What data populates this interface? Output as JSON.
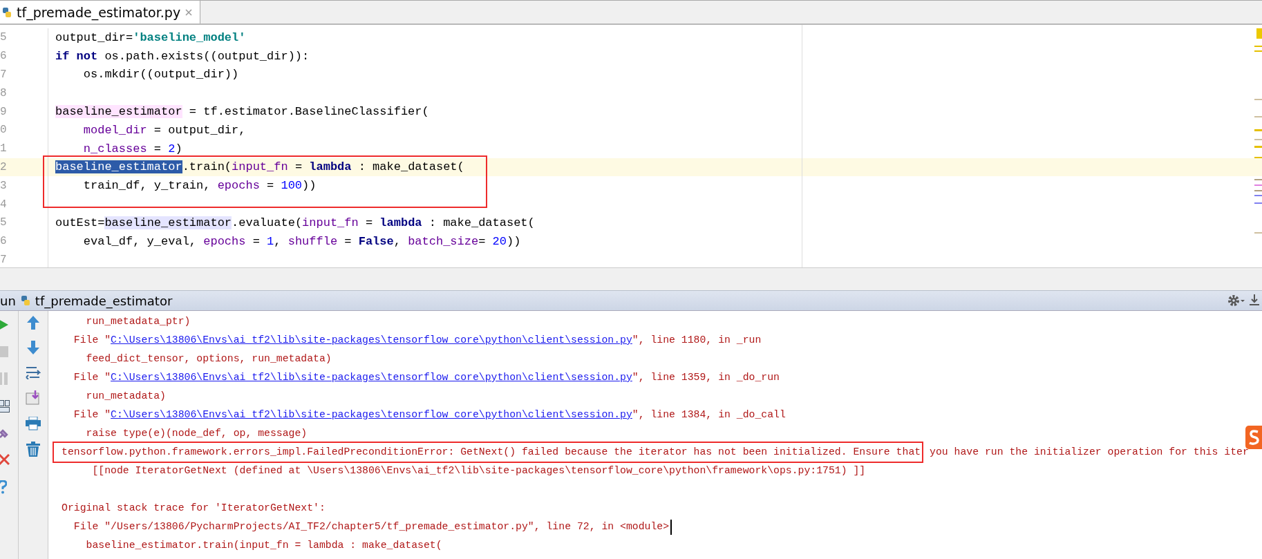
{
  "tab": {
    "label": "tf_premade_estimator.py",
    "selected": true
  },
  "editor": {
    "lines": [
      {
        "number": "5",
        "caret_line": false,
        "tokens": [
          {
            "kind": "plain",
            "text": "output_dir="
          },
          {
            "kind": "string",
            "text": "'baseline_model'"
          }
        ]
      },
      {
        "number": "6",
        "caret_line": false,
        "tokens": [
          {
            "kind": "keyword",
            "text": "if"
          },
          {
            "kind": "keyword",
            "text": " not"
          },
          {
            "kind": "plain",
            "text": " os.path.exists((output_dir)):"
          }
        ]
      },
      {
        "number": "7",
        "caret_line": false,
        "tokens": [
          {
            "kind": "plain",
            "text": "    os.mkdir((output_dir))"
          }
        ]
      },
      {
        "number": "8",
        "caret_line": false
      },
      {
        "number": "9",
        "caret_line": false,
        "tokens": [
          {
            "kind": "write-usage",
            "text": "baseline_estimator"
          },
          {
            "kind": "plain",
            "text": " = tf.estimator.BaselineClassifier("
          }
        ]
      },
      {
        "number": "0",
        "caret_line": false,
        "tokens": [
          {
            "kind": "param",
            "text": "    model_dir"
          },
          {
            "kind": "plain",
            "text": " = output_dir,"
          }
        ]
      },
      {
        "number": "1",
        "caret_line": false,
        "tokens": [
          {
            "kind": "param",
            "text": "    n_classes"
          },
          {
            "kind": "plain",
            "text": " = "
          },
          {
            "kind": "number",
            "text": "2"
          },
          {
            "kind": "plain",
            "text": ")"
          }
        ]
      },
      {
        "number": "2",
        "caret_line": true,
        "tokens": [
          {
            "kind": "selection",
            "text": "baseline_estimator"
          },
          {
            "kind": "plain",
            "text": ".train("
          },
          {
            "kind": "param",
            "text": "input_fn"
          },
          {
            "kind": "plain",
            "text": " = "
          },
          {
            "kind": "keyword",
            "text": "lambda"
          },
          {
            "kind": "plain",
            "text": " : make_dataset("
          }
        ]
      },
      {
        "number": "3",
        "caret_line": false,
        "tokens": [
          {
            "kind": "plain",
            "text": "    train_df, y_train, "
          },
          {
            "kind": "param",
            "text": "epochs"
          },
          {
            "kind": "plain",
            "text": " = "
          },
          {
            "kind": "number",
            "text": "100"
          },
          {
            "kind": "plain",
            "text": "))"
          }
        ]
      },
      {
        "number": "4",
        "caret_line": false
      },
      {
        "number": "5",
        "caret_line": false,
        "tokens": [
          {
            "kind": "plain",
            "text": "outEst="
          },
          {
            "kind": "read-usage",
            "text": "baseline_estimator"
          },
          {
            "kind": "plain",
            "text": ".evaluate("
          },
          {
            "kind": "param",
            "text": "input_fn"
          },
          {
            "kind": "plain",
            "text": " = "
          },
          {
            "kind": "keyword",
            "text": "lambda"
          },
          {
            "kind": "plain",
            "text": " : make_dataset("
          }
        ]
      },
      {
        "number": "6",
        "caret_line": false,
        "tokens": [
          {
            "kind": "plain",
            "text": "    eval_df, y_eval, "
          },
          {
            "kind": "param",
            "text": "epochs"
          },
          {
            "kind": "plain",
            "text": " = "
          },
          {
            "kind": "number",
            "text": "1"
          },
          {
            "kind": "plain",
            "text": ", "
          },
          {
            "kind": "param",
            "text": "shuffle"
          },
          {
            "kind": "plain",
            "text": " = "
          },
          {
            "kind": "keyword",
            "text": "False"
          },
          {
            "kind": "plain",
            "text": ", "
          },
          {
            "kind": "param",
            "text": "batch_size"
          },
          {
            "kind": "plain",
            "text": "= "
          },
          {
            "kind": "number",
            "text": "20"
          },
          {
            "kind": "plain",
            "text": "))"
          }
        ]
      },
      {
        "number": "7",
        "caret_line": false
      }
    ]
  },
  "run_panel": {
    "label": "un",
    "config_name": "tf_premade_estimator",
    "console_lines": [
      {
        "kind": "text",
        "tokens": [
          {
            "kind": "plain",
            "text": "    run_metadata_ptr)"
          }
        ]
      },
      {
        "kind": "text",
        "tokens": [
          {
            "kind": "plain",
            "text": "  File \""
          },
          {
            "kind": "link",
            "text": "C:\\Users\\13806\\Envs\\ai_tf2\\lib\\site-packages\\tensorflow_core\\python\\client\\session.py"
          },
          {
            "kind": "plain",
            "text": "\", line 1180, in _run"
          }
        ]
      },
      {
        "kind": "text",
        "tokens": [
          {
            "kind": "plain",
            "text": "    feed_dict_tensor, options, run_metadata)"
          }
        ]
      },
      {
        "kind": "text",
        "tokens": [
          {
            "kind": "plain",
            "text": "  File \""
          },
          {
            "kind": "link",
            "text": "C:\\Users\\13806\\Envs\\ai_tf2\\lib\\site-packages\\tensorflow_core\\python\\client\\session.py"
          },
          {
            "kind": "plain",
            "text": "\", line 1359, in _do_run"
          }
        ]
      },
      {
        "kind": "text",
        "tokens": [
          {
            "kind": "plain",
            "text": "    run_metadata)"
          }
        ]
      },
      {
        "kind": "text",
        "tokens": [
          {
            "kind": "plain",
            "text": "  File \""
          },
          {
            "kind": "link",
            "text": "C:\\Users\\13806\\Envs\\ai_tf2\\lib\\site-packages\\tensorflow_core\\python\\client\\session.py"
          },
          {
            "kind": "plain",
            "text": "\", line 1384, in _do_call"
          }
        ]
      },
      {
        "kind": "text",
        "tokens": [
          {
            "kind": "plain",
            "text": "    raise type(e)(node_def, op, message)"
          }
        ]
      },
      {
        "kind": "text",
        "tokens": [
          {
            "kind": "framed",
            "text": "tensorflow.python.framework.errors_impl.FailedPreconditionError: GetNext() failed because the iterator has not been initialized. Ensure that"
          },
          {
            "kind": "plain",
            "text": " you have run the initializer operation for this iter"
          }
        ]
      },
      {
        "kind": "text",
        "tokens": [
          {
            "kind": "plain",
            "text": "     [[node IteratorGetNext (defined at \\Users\\13806\\Envs\\ai_tf2\\lib\\site-packages\\tensorflow_core\\python\\framework\\ops.py:1751) ]]"
          }
        ]
      },
      {
        "kind": "blank"
      },
      {
        "kind": "text",
        "tokens": [
          {
            "kind": "plain",
            "text": "Original stack trace for 'IteratorGetNext':"
          }
        ]
      },
      {
        "kind": "text",
        "cursor": true,
        "tokens": [
          {
            "kind": "plain",
            "text": "  File \"/Users/13806/PycharmProjects/AI_TF2/chapter5/tf_premade_estimator.py\", line 72, in <module>"
          }
        ]
      },
      {
        "kind": "text",
        "tokens": [
          {
            "kind": "plain",
            "text": "    baseline_estimator.train(input_fn = lambda : make_dataset("
          }
        ]
      }
    ]
  }
}
